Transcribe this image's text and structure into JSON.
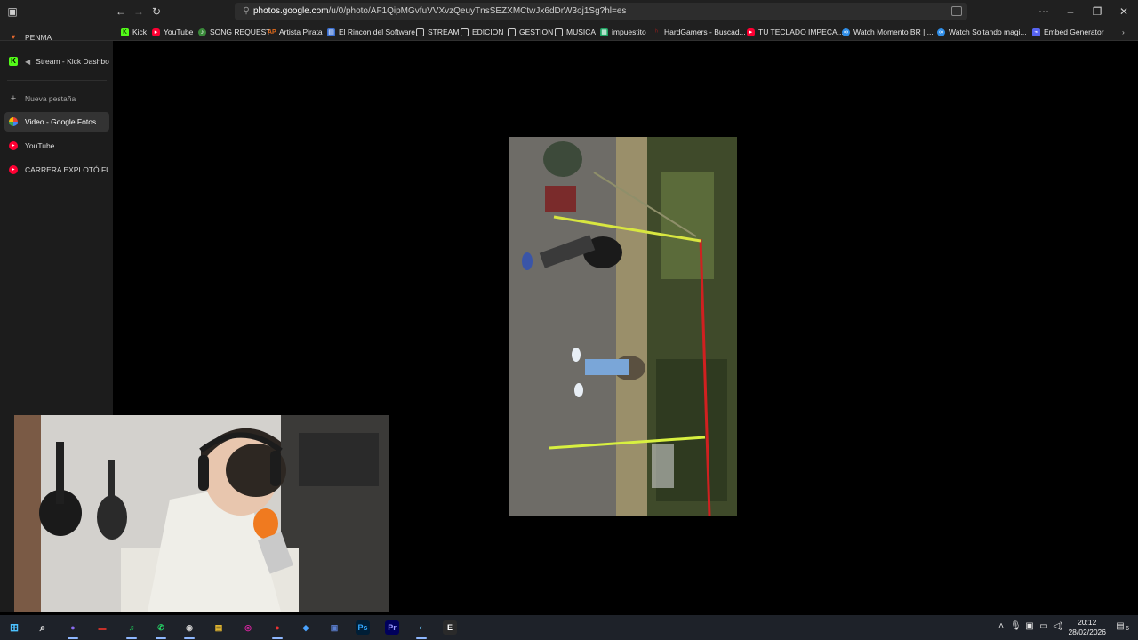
{
  "browser": {
    "url_host": "photos.google.com",
    "url_path": "/u/0/photo/AF1QipMGvfuVVXvzQeuyTnsSEZXMCtwJx6dDrW3oj1Sg?hl=es"
  },
  "bookmarks": [
    {
      "label": "Kick",
      "icon": "kick-icon",
      "color": "#53fc18"
    },
    {
      "label": "YouTube",
      "icon": "youtube-icon",
      "color": "#ff0033"
    },
    {
      "label": "SONG REQUEST",
      "icon": "song-request-icon",
      "color": "#3a8a3a"
    },
    {
      "label": "Artista Pirata",
      "icon": "artista-pirata-icon",
      "color": "#e06a1b"
    },
    {
      "label": "El Rincon del Software",
      "icon": "rincon-software-icon",
      "color": "#3b6fd1"
    },
    {
      "label": "STREAM",
      "icon": "folder-icon",
      "color": "#cfcfcf"
    },
    {
      "label": "EDICION",
      "icon": "folder-icon",
      "color": "#cfcfcf"
    },
    {
      "label": "GESTION",
      "icon": "folder-icon",
      "color": "#cfcfcf"
    },
    {
      "label": "MUSICA",
      "icon": "folder-icon",
      "color": "#cfcfcf"
    },
    {
      "label": "impuestito",
      "icon": "sheets-icon",
      "color": "#1fa463"
    },
    {
      "label": "HardGamers - Buscad...",
      "icon": "hardgamers-icon",
      "color": "#b01c1c"
    },
    {
      "label": "TU TECLADO IMPECA...",
      "icon": "youtube-icon",
      "color": "#ff0033"
    },
    {
      "label": "Watch Momento BR | ...",
      "icon": "watch-icon",
      "color": "#2f8ee8"
    },
    {
      "label": "Watch Soltando magi...",
      "icon": "watch-icon",
      "color": "#2f8ee8"
    },
    {
      "label": "Embed Generator",
      "icon": "embed-icon",
      "color": "#5865f2"
    }
  ],
  "sidebar": {
    "items": [
      {
        "label": "PENMA",
        "icon": "heart-icon",
        "color": "#e8692e"
      },
      {
        "label": "Stream - Kick Dashbo",
        "icon": "kick-icon",
        "color": "#53fc18",
        "muted": true
      },
      {
        "label": "Nueva pestaña",
        "icon": "plus-icon",
        "color": "#a8a8a8"
      },
      {
        "label": "Video - Google Fotos",
        "icon": "google-photos-icon",
        "color": "#f4b400",
        "active": true
      },
      {
        "label": "YouTube",
        "icon": "youtube-icon",
        "color": "#ff0033"
      },
      {
        "label": "CARRERA EXPLOTÓ FUER",
        "icon": "youtube-icon",
        "color": "#ff0033"
      }
    ]
  },
  "taskbar": {
    "time": "20:12",
    "date": "28/02/2026",
    "notification_count": "6",
    "apps": [
      {
        "name": "start-icon",
        "color": "#4cc2ff",
        "text": "⊞"
      },
      {
        "name": "search-icon",
        "color": "#e0e0e0",
        "text": "⌕"
      },
      {
        "name": "browser-icon",
        "color": "#8a6cf0",
        "text": "●"
      },
      {
        "name": "media-app-icon",
        "color": "#c6312a",
        "text": "▬"
      },
      {
        "name": "spotify-icon",
        "color": "#1db954",
        "text": "♫"
      },
      {
        "name": "whatsapp-icon",
        "color": "#25d366",
        "text": "✆"
      },
      {
        "name": "obs-icon",
        "color": "#cfcfcf",
        "text": "◉"
      },
      {
        "name": "file-explorer-icon",
        "color": "#f4c430",
        "text": "▤"
      },
      {
        "name": "instagram-icon",
        "color": "#d6249f",
        "text": "◎"
      },
      {
        "name": "record-icon",
        "color": "#e33",
        "text": "●"
      },
      {
        "name": "vpn-icon",
        "color": "#4aa3ff",
        "text": "◆"
      },
      {
        "name": "monitor-icon",
        "color": "#5b7fcf",
        "text": "▣"
      },
      {
        "name": "photoshop-icon",
        "color": "#31a8ff",
        "text": "Ps"
      },
      {
        "name": "premiere-icon",
        "color": "#9999ff",
        "text": "Pr"
      },
      {
        "name": "steam-icon",
        "color": "#66c0f4",
        "text": "◐"
      },
      {
        "name": "epic-games-icon",
        "color": "#ffffff",
        "text": "E"
      }
    ]
  }
}
